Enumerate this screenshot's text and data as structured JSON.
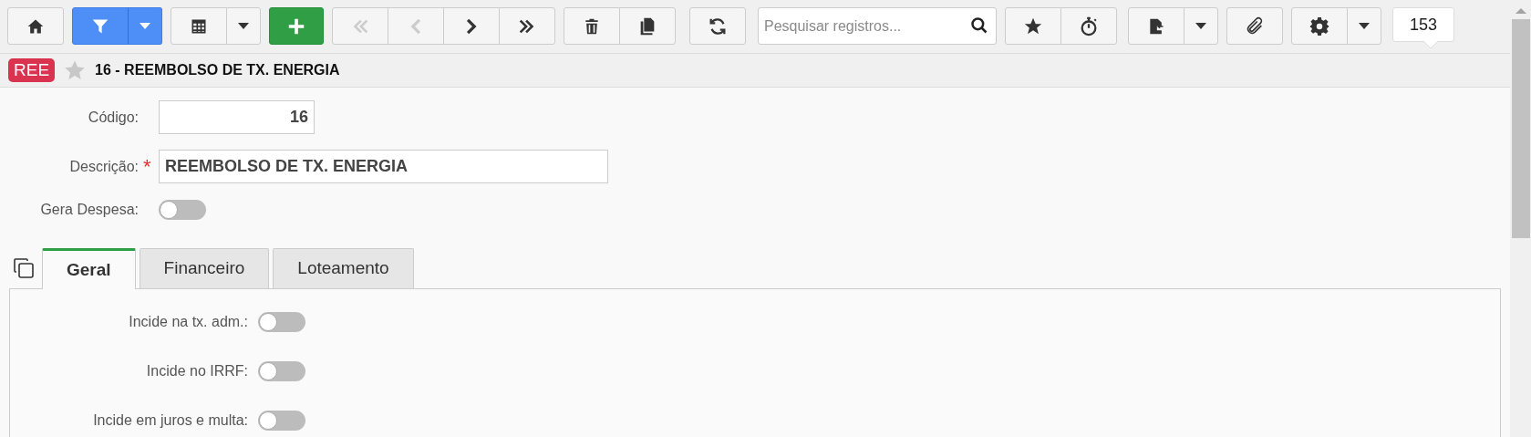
{
  "toolbar": {
    "filter": {
      "active": true
    },
    "navigation": [
      {
        "disabled": true
      },
      {
        "disabled": true
      },
      {
        "disabled": false
      },
      {
        "disabled": false
      }
    ],
    "search": {
      "placeholder": "Pesquisar registros..."
    },
    "record_count": "153"
  },
  "header": {
    "badge": "REE",
    "favorite": false,
    "title": "16 - REEMBOLSO DE TX. ENERGIA"
  },
  "form": {
    "code": {
      "label": "Código:",
      "value": "16"
    },
    "description": {
      "label": "Descrição:",
      "required_mark": "*",
      "value": "REEMBOLSO DE TX. ENERGIA"
    },
    "generates_expense": {
      "label": "Gera Despesa:",
      "on": false
    }
  },
  "tabs": [
    {
      "label": "Geral",
      "selected": true
    },
    {
      "label": "Financeiro",
      "selected": false
    },
    {
      "label": "Loteamento",
      "selected": false
    }
  ],
  "tab_panel": {
    "switches": [
      {
        "label": "Incide na tx. adm.:",
        "on": false
      },
      {
        "label": "Incide no IRRF:",
        "on": false
      },
      {
        "label": "Incide em juros e multa:",
        "on": false
      }
    ]
  }
}
